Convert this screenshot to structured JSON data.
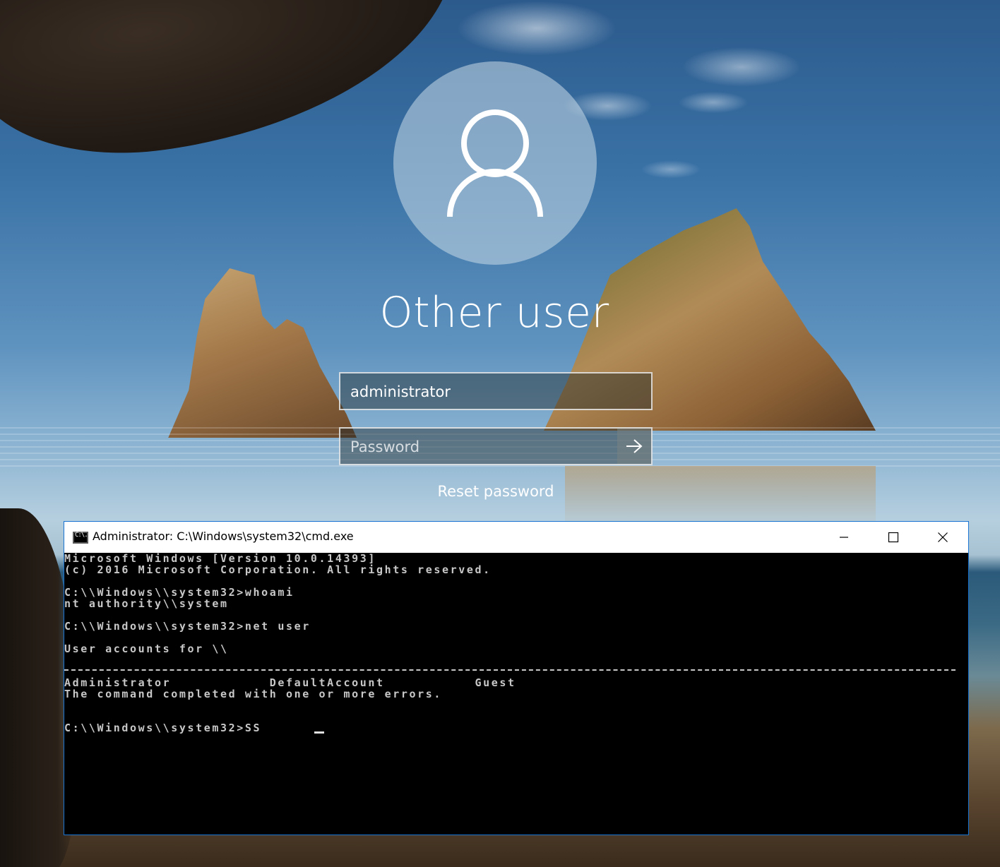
{
  "login": {
    "user_display_name": "Other user",
    "username_value": "administrator",
    "password_placeholder": "Password",
    "reset_password_label": "Reset password"
  },
  "cmd_window": {
    "title": "Administrator: C:\\Windows\\system32\\cmd.exe",
    "icon_label": "C:\\.",
    "lines": [
      "Microsoft Windows [Version 10.0.14393]",
      "(c) 2016 Microsoft Corporation. All rights reserved.",
      "C:\\\\Windows\\\\system32>whoami",
      "nt authority\\\\system",
      "C:\\\\Windows\\\\system32>net user",
      "User accounts for \\\\",
      "Administrator            DefaultAccount           Guest",
      "The command completed with one or more errors.",
      "C:\\\\Windows\\\\system32>SS"
    ]
  },
  "icons": {
    "avatar": "user-silhouette-icon",
    "submit": "arrow-right-icon",
    "cmd": "command-prompt-icon",
    "minimize": "minimize-icon",
    "maximize": "maximize-icon",
    "close": "close-icon"
  }
}
